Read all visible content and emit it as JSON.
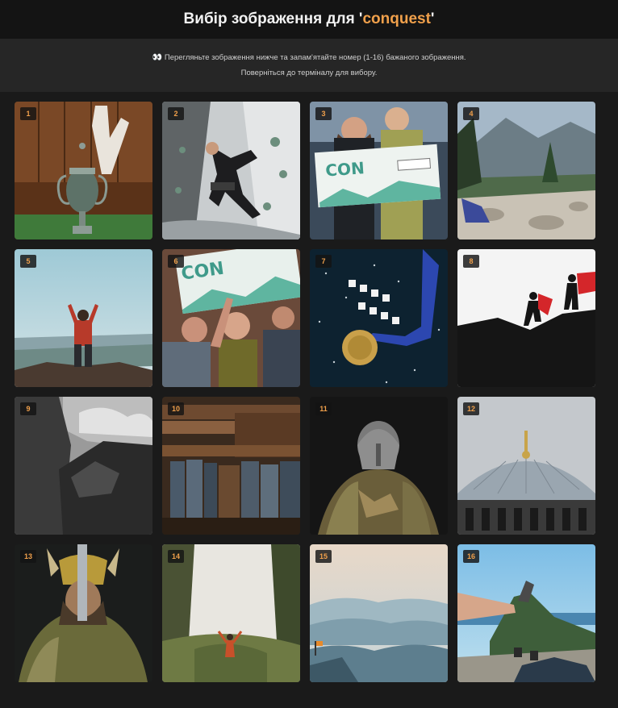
{
  "header": {
    "title_prefix": "Вибір зображення для '",
    "keyword": "conquest",
    "title_suffix": "'"
  },
  "info": {
    "icon": "eyes-icon",
    "line1": "Перегляньте зображення нижче та запам'ятайте номер (1-16) бажаного зображення.",
    "line2": "Поверніться до терміналу для вибору."
  },
  "images": [
    {
      "number": "1",
      "subject": "trophy"
    },
    {
      "number": "2",
      "subject": "climbing-wall"
    },
    {
      "number": "3",
      "subject": "itcon-check-winners"
    },
    {
      "number": "4",
      "subject": "mountain-summit-rest"
    },
    {
      "number": "5",
      "subject": "man-on-summit"
    },
    {
      "number": "6",
      "subject": "itcon-team-celebration"
    },
    {
      "number": "7",
      "subject": "gold-medal"
    },
    {
      "number": "8",
      "subject": "flag-climbers-silhouette"
    },
    {
      "number": "9",
      "subject": "rocky-mountain-bw"
    },
    {
      "number": "10",
      "subject": "old-books"
    },
    {
      "number": "11",
      "subject": "viking-warrior"
    },
    {
      "number": "12",
      "subject": "mosque-dome"
    },
    {
      "number": "13",
      "subject": "viking-helmet-warrior"
    },
    {
      "number": "14",
      "subject": "misty-forest-hiker"
    },
    {
      "number": "15",
      "subject": "misty-mountain-layers"
    },
    {
      "number": "16",
      "subject": "cliff-view-feet"
    }
  ],
  "colors": {
    "accent": "#f0a04b",
    "background": "#1a1a1a",
    "header_bg": "#141414",
    "info_bg": "#262626"
  }
}
